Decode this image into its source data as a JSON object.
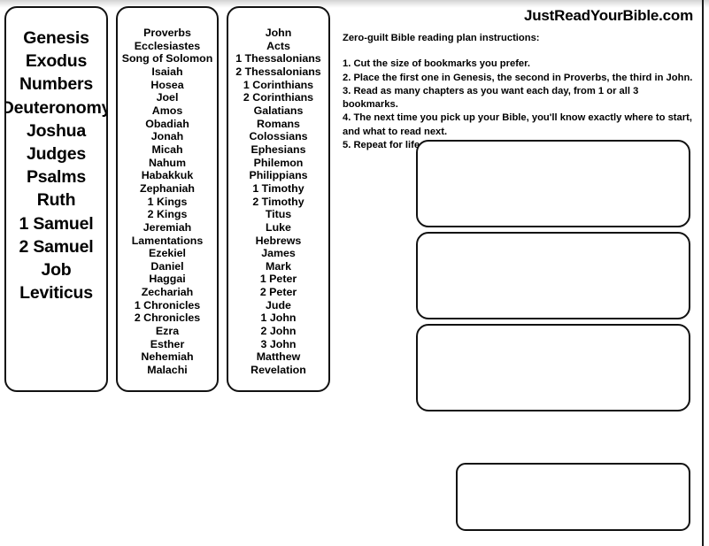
{
  "site": {
    "title": "JustReadYourBible.com"
  },
  "instructions": {
    "heading": "Zero-guilt Bible reading plan instructions:",
    "steps": [
      "1. Cut the size of bookmarks you prefer.",
      "2. Place the first one in Genesis, the second in Proverbs, the third in John.",
      "3. Read as many chapters as you want each day, from 1 or all 3 bookmarks.",
      "4. The next time you pick up your Bible, you'll know exactly where to start, and what to read next.",
      "5. Repeat for life."
    ]
  },
  "bookmarks": {
    "genesis": {
      "name": "genesis-bookmark",
      "books": [
        "Genesis",
        "Exodus",
        "Numbers",
        "Deuteronomy",
        "Joshua",
        "Judges",
        "Psalms",
        "Ruth",
        "1 Samuel",
        "2 Samuel",
        "Job",
        "Leviticus"
      ]
    },
    "proverbs": {
      "name": "proverbs-bookmark",
      "books": [
        "Proverbs",
        "Ecclesiastes",
        "Song of Solomon",
        "Isaiah",
        "Hosea",
        "Joel",
        "Amos",
        "Obadiah",
        "Jonah",
        "Micah",
        "Nahum",
        "Habakkuk",
        "Zephaniah",
        "1 Kings",
        "2 Kings",
        "Jeremiah",
        "Lamentations",
        "Ezekiel",
        "Daniel",
        "Haggai",
        "Zechariah",
        "1 Chronicles",
        "2 Chronicles",
        "Ezra",
        "Esther",
        "Nehemiah",
        "Malachi"
      ]
    },
    "john": {
      "name": "john-bookmark",
      "books": [
        "John",
        "Acts",
        "1 Thessalonians",
        "2 Thessalonians",
        "1 Corinthians",
        "2 Corinthians",
        "Galatians",
        "Romans",
        "Colossians",
        "Ephesians",
        "Philemon",
        "Philippians",
        "1 Timothy",
        "2 Timothy",
        "Titus",
        "Luke",
        "Hebrews",
        "James",
        "Mark",
        "1 Peter",
        "2 Peter",
        "Jude",
        "1 John",
        "2 John",
        "3 John",
        "Matthew",
        "Revelation"
      ]
    }
  },
  "colors": {
    "ink": "#000000",
    "card_border": "#111111",
    "paper": "#ffffff",
    "page_edge": "#1a1a1a"
  }
}
